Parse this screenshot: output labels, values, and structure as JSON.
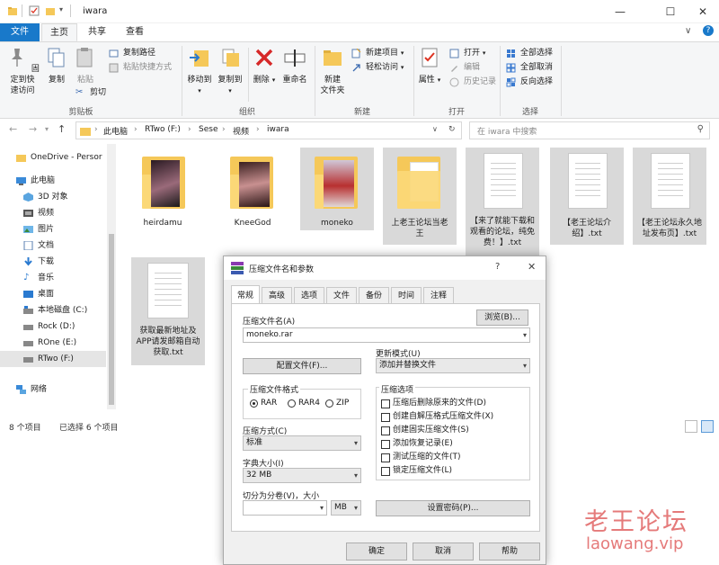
{
  "window": {
    "title": "iwara",
    "minimize": "—",
    "maximize": "☐",
    "close": "✕",
    "help": "?",
    "collapse": "∨"
  },
  "ribbon_tabs": [
    "文件",
    "主页",
    "共享",
    "查看"
  ],
  "ribbon": {
    "clipboard": {
      "pin": "固定到快\n速访问",
      "copy": "复制",
      "paste": "粘贴",
      "copy_path": "复制路径",
      "paste_shortcut": "粘贴快捷方式",
      "cut": "剪切",
      "label": "剪贴板"
    },
    "organize": {
      "move_to": "移动到",
      "copy_to": "复制到",
      "delete": "删除",
      "rename": "重命名",
      "label": "组织"
    },
    "new": {
      "new_folder": "新建\n文件夹",
      "new_item": "新建项目",
      "easy_access": "轻松访问",
      "label": "新建"
    },
    "open": {
      "properties": "属性",
      "open": "打开",
      "edit": "编辑",
      "history": "历史记录",
      "label": "打开"
    },
    "select": {
      "select_all": "全部选择",
      "select_none": "全部取消",
      "invert": "反向选择",
      "label": "选择"
    }
  },
  "address": {
    "crumbs": [
      "此电脑",
      "RTwo (F:)",
      "Sese",
      "视频",
      "iwara"
    ],
    "search_placeholder": "在 iwara 中搜索"
  },
  "sidebar": {
    "items": [
      {
        "label": "OneDrive - Persor"
      },
      {
        "label": "此电脑"
      },
      {
        "label": "3D 对象"
      },
      {
        "label": "视频"
      },
      {
        "label": "图片"
      },
      {
        "label": "文档"
      },
      {
        "label": "下载"
      },
      {
        "label": "音乐"
      },
      {
        "label": "桌面"
      },
      {
        "label": "本地磁盘 (C:)"
      },
      {
        "label": "Rock (D:)"
      },
      {
        "label": "ROne (E:)"
      },
      {
        "label": "RTwo (F:)"
      },
      {
        "label": "网络"
      }
    ]
  },
  "files": [
    {
      "name": "heirdamu",
      "kind": "video-folder",
      "selected": false
    },
    {
      "name": "KneeGod",
      "kind": "video-folder",
      "selected": false
    },
    {
      "name": "moneko",
      "kind": "video-folder",
      "selected": true
    },
    {
      "name": "上老王论坛当老王",
      "kind": "folder",
      "selected": true
    },
    {
      "name": "【来了就能下载和观看的论坛，纯免费！】.txt",
      "kind": "txt",
      "selected": true
    },
    {
      "name": "【老王论坛介绍】.txt",
      "kind": "txt",
      "selected": true
    },
    {
      "name": "【老王论坛永久地址发布页】.txt",
      "kind": "txt",
      "selected": true
    },
    {
      "name": "获取最新地址及APP请发邮箱自动获取.txt",
      "kind": "txt",
      "selected": true
    }
  ],
  "status": {
    "count": "8 个项目",
    "selected": "已选择 6 个项目"
  },
  "dialog": {
    "title": "压缩文件名和参数",
    "help": "?",
    "close": "✕",
    "tabs": [
      "常规",
      "高级",
      "选项",
      "文件",
      "备份",
      "时间",
      "注释"
    ],
    "archive_name_label": "压缩文件名(A)",
    "browse": "浏览(B)...",
    "archive_name_value": "moneko.rar",
    "update_mode_label": "更新模式(U)",
    "update_mode_value": "添加并替换文件",
    "profiles": "配置文件(F)...",
    "format_label": "压缩文件格式",
    "formats": [
      "RAR",
      "RAR4",
      "ZIP"
    ],
    "format_selected": "RAR",
    "method_label": "压缩方式(C)",
    "method_value": "标准",
    "dict_label": "字典大小(I)",
    "dict_value": "32 MB",
    "split_label": "切分为分卷(V)，大小",
    "split_value": "",
    "split_unit": "MB",
    "options_label": "压缩选项",
    "options": [
      "压缩后删除原来的文件(D)",
      "创建自解压格式压缩文件(X)",
      "创建固实压缩文件(S)",
      "添加恢复记录(E)",
      "测试压缩的文件(T)",
      "锁定压缩文件(L)"
    ],
    "set_password": "设置密码(P)...",
    "ok": "确定",
    "cancel": "取消",
    "help_btn": "帮助"
  },
  "watermark": {
    "line1": "老王论坛",
    "line2": "laowang.vip"
  },
  "colors": {
    "accent": "#1979ca",
    "folder": "#f5c859",
    "selection": "#d9d9d9",
    "watermark": "#e57a7a"
  }
}
